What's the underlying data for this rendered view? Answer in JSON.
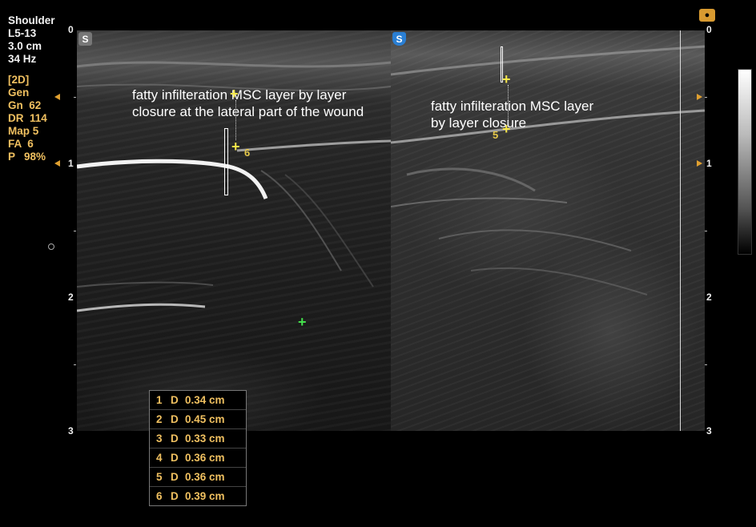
{
  "info": {
    "preset": "Shoulder",
    "probe": "L5-13",
    "depth": "3.0 cm",
    "framerate": "34 Hz",
    "mode": "[2D]",
    "gen": "Gen",
    "gn": "Gn  62",
    "dr": "DR  114",
    "map": "Map 5",
    "fa": "FA  6",
    "p": "P   98%"
  },
  "orientation_marker": "S",
  "scale": {
    "left": [
      "0",
      "1",
      "2",
      "3"
    ],
    "right": [
      "0",
      "1",
      "2",
      "3"
    ]
  },
  "annotations": {
    "left": "fatty infilteration MSC layer by layer\nclosure at the lateral part of the wound",
    "right": "fatty infilteration MSC layer\nby layer closure"
  },
  "calipers": {
    "left_label": "6",
    "right_label": "5"
  },
  "measurements": [
    {
      "idx": "1",
      "type": "D",
      "value": "0.34 cm"
    },
    {
      "idx": "2",
      "type": "D",
      "value": "0.45 cm"
    },
    {
      "idx": "3",
      "type": "D",
      "value": "0.33 cm"
    },
    {
      "idx": "4",
      "type": "D",
      "value": "0.36 cm"
    },
    {
      "idx": "5",
      "type": "D",
      "value": "0.36 cm"
    },
    {
      "idx": "6",
      "type": "D",
      "value": "0.39 cm"
    }
  ],
  "colors": {
    "caliper": "#f7e84a",
    "text_yellow": "#f0c060",
    "cursor_green": "#44e04c",
    "marker": "#e0a030"
  },
  "icons": {
    "top_right": "probe-icon",
    "cursor": "crosshair-icon"
  }
}
